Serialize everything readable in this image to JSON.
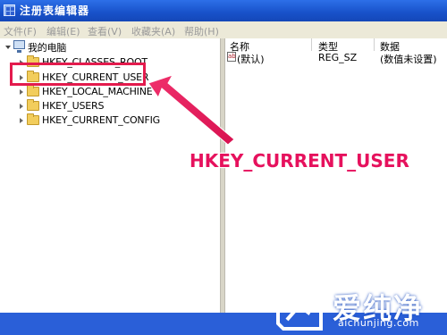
{
  "window": {
    "title": "注册表编辑器"
  },
  "menu": [
    {
      "label": "文件(F)"
    },
    {
      "label": "编辑(E)"
    },
    {
      "label": "查看(V)"
    },
    {
      "label": "收藏夹(A)"
    },
    {
      "label": "帮助(H)"
    }
  ],
  "tree": {
    "root": "我的电脑",
    "items": [
      {
        "label": "HKEY_CLASSES_ROOT"
      },
      {
        "label": "HKEY_CURRENT_USER"
      },
      {
        "label": "HKEY_LOCAL_MACHINE"
      },
      {
        "label": "HKEY_USERS"
      },
      {
        "label": "HKEY_CURRENT_CONFIG"
      }
    ]
  },
  "values_pane": {
    "columns": {
      "name": "名称",
      "type": "类型",
      "data": "数据"
    },
    "rows": [
      {
        "name": "(默认)",
        "type": "REG_SZ",
        "data": "(数值未设置)"
      }
    ]
  },
  "annotation": {
    "callout": "HKEY_CURRENT_USER",
    "color": "#e6115d"
  },
  "watermark": {
    "brand": "爱纯净",
    "domain": "aichunjing.com"
  }
}
